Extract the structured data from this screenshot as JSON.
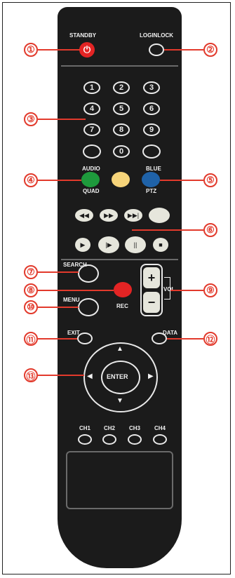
{
  "buttons": {
    "standby": "STANDBY",
    "loginlock": "LOGINLOCK",
    "audio": "AUDIO",
    "quad": "QUAD",
    "blank_green": "",
    "ptz": "PTZ",
    "blue_top": "BLUE",
    "search": "SEARCH",
    "rec": "REC",
    "menu": "MENU",
    "vol": "VOL",
    "exit": "EXIT",
    "data": "DATA",
    "enter": "ENTER",
    "ch1": "CH1",
    "ch2": "CH2",
    "ch3": "CH3",
    "ch4": "CH4"
  },
  "numbers": [
    "1",
    "2",
    "3",
    "4",
    "5",
    "6",
    "7",
    "8",
    "9",
    "",
    "0",
    ""
  ],
  "playback_icons": [
    "◀◀",
    "▶▶",
    "▶▶|",
    "",
    "▶",
    "|▶",
    "||",
    "■"
  ],
  "callouts": [
    "①",
    "②",
    "③",
    "④",
    "⑤",
    "⑥",
    "⑦",
    "⑧",
    "⑨",
    "⑩",
    "⑪",
    "⑫",
    "⑬"
  ],
  "colors": {
    "red": "#e32424",
    "green": "#1e9a3c",
    "yellow": "#f6d47a",
    "blue": "#1f62a8",
    "callout": "#e23a2c"
  }
}
